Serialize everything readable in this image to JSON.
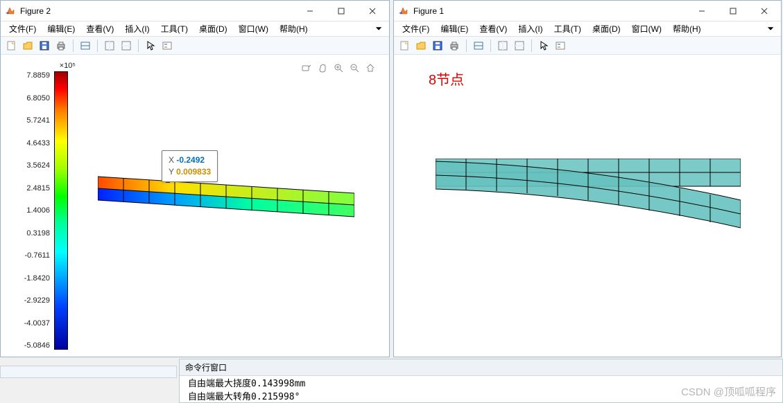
{
  "figure2": {
    "title": "Figure 2",
    "menu": [
      "文件(F)",
      "编辑(E)",
      "查看(V)",
      "插入(I)",
      "工具(T)",
      "桌面(D)",
      "窗口(W)",
      "帮助(H)"
    ],
    "colorbar": {
      "exp": "×10⁵",
      "ticks": [
        "7.8859",
        "6.8050",
        "5.7241",
        "4.6433",
        "3.5624",
        "2.4815",
        "1.4006",
        "0.3198",
        "-0.7611",
        "-1.8420",
        "-2.9229",
        "-4.0037",
        "-5.0846"
      ]
    },
    "datatip": {
      "xlabel": "X",
      "xval": "-0.2492",
      "ylabel": "Y",
      "yval": "0.009833"
    }
  },
  "figure1": {
    "title": "Figure 1",
    "menu": [
      "文件(F)",
      "编辑(E)",
      "查看(V)",
      "插入(I)",
      "工具(T)",
      "桌面(D)",
      "窗口(W)",
      "帮助(H)"
    ],
    "plot_title": "8节点"
  },
  "command_window": {
    "title": "命令行窗口",
    "lines": [
      "自由端最大挠度0.143998mm",
      "自由端最大转角0.215998°"
    ]
  },
  "chart_data": [
    {
      "type": "heatmap",
      "title": "Figure 2 — stress contour on deformed mesh",
      "colorbar_label": "×10⁵",
      "value_range": [
        -5.0846,
        7.8859
      ],
      "grid": {
        "cols": 10,
        "rows": 2
      },
      "deformation": "beam bends slightly downward on right end",
      "datatip": {
        "x": -0.2492,
        "y": 0.009833
      }
    },
    {
      "type": "other",
      "title": "Figure 1 — 8节点 (8-node) element mesh, undeformed + deformed overlay",
      "grid": {
        "cols": 10,
        "rows": 2
      },
      "fill": "teal",
      "overlay": "undeformed straight mesh + deformed bent mesh"
    }
  ],
  "watermark": "CSDN @顶呱呱程序"
}
